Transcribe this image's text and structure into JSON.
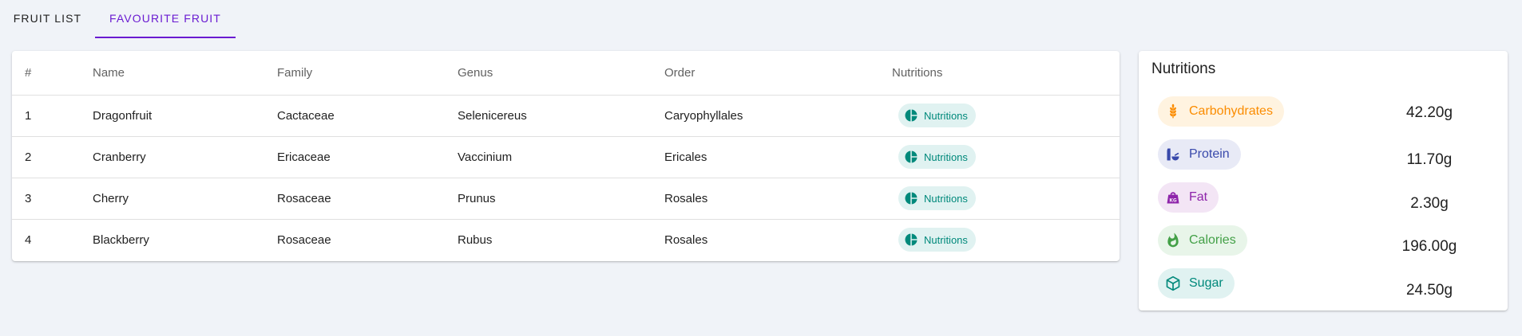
{
  "tabs": [
    {
      "label": "FRUIT LIST",
      "active": false
    },
    {
      "label": "FAVOURITE FRUIT",
      "active": true
    }
  ],
  "table": {
    "headers": [
      "#",
      "Name",
      "Family",
      "Genus",
      "Order",
      "Nutritions"
    ],
    "rows": [
      {
        "idx": "1",
        "name": "Dragonfruit",
        "family": "Cactaceae",
        "genus": "Selenicereus",
        "order": "Caryophyllales",
        "chip": "Nutritions"
      },
      {
        "idx": "2",
        "name": "Cranberry",
        "family": "Ericaceae",
        "genus": "Vaccinium",
        "order": "Ericales",
        "chip": "Nutritions"
      },
      {
        "idx": "3",
        "name": "Cherry",
        "family": "Rosaceae",
        "genus": "Prunus",
        "order": "Rosales",
        "chip": "Nutritions"
      },
      {
        "idx": "4",
        "name": "Blackberry",
        "family": "Rosaceae",
        "genus": "Rubus",
        "order": "Rosales",
        "chip": "Nutritions"
      }
    ]
  },
  "nutrition_panel": {
    "title": "Nutritions",
    "items": [
      {
        "label": "Carbohydrates",
        "value": "42.20g",
        "icon": "wheat-icon",
        "color": "#fb8c00"
      },
      {
        "label": "Protein",
        "value": "11.70g",
        "icon": "protein-icon",
        "color": "#3949ab"
      },
      {
        "label": "Fat",
        "value": "2.30g",
        "icon": "weight-icon",
        "color": "#8e24aa"
      },
      {
        "label": "Calories",
        "value": "196.00g",
        "icon": "flame-icon",
        "color": "#43a047"
      },
      {
        "label": "Sugar",
        "value": "24.50g",
        "icon": "cube-icon",
        "color": "#00897b"
      }
    ]
  },
  "colors": {
    "accent": "#6a1bd1",
    "chip_teal": "#00897b",
    "chip_teal_bg": "#e0f2f1"
  }
}
